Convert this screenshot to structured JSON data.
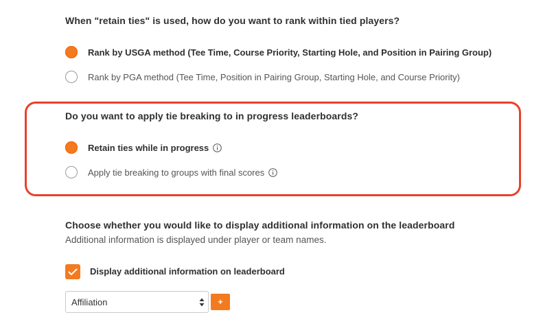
{
  "rank_section": {
    "question": "When \"retain ties\" is used, how do you want to rank within tied players?",
    "options": [
      {
        "label": "Rank by USGA method (Tee Time, Course Priority, Starting Hole, and Position in Pairing Group)",
        "selected": true
      },
      {
        "label": "Rank by PGA method (Tee Time, Position in Pairing Group, Starting Hole, and Course Priority)",
        "selected": false
      }
    ]
  },
  "tiebreak_section": {
    "question": "Do you want to apply tie breaking to in progress leaderboards?",
    "options": [
      {
        "label": "Retain ties while in progress",
        "selected": true,
        "icon": "info-icon"
      },
      {
        "label": "Apply tie breaking to groups with final scores",
        "selected": false,
        "icon": "info-icon"
      }
    ],
    "highlight_color": "#e8402a"
  },
  "additional_info_section": {
    "title": "Choose whether you would like to display additional information on the leaderboard",
    "subtitle": "Additional information is displayed under player or team names.",
    "checkbox": {
      "label": "Display additional information on leaderboard",
      "checked": true
    },
    "select": {
      "value": "Affiliation"
    },
    "add_button": {
      "label": "+"
    }
  },
  "colors": {
    "accent": "#f47a1f",
    "highlight_border": "#e8402a"
  }
}
